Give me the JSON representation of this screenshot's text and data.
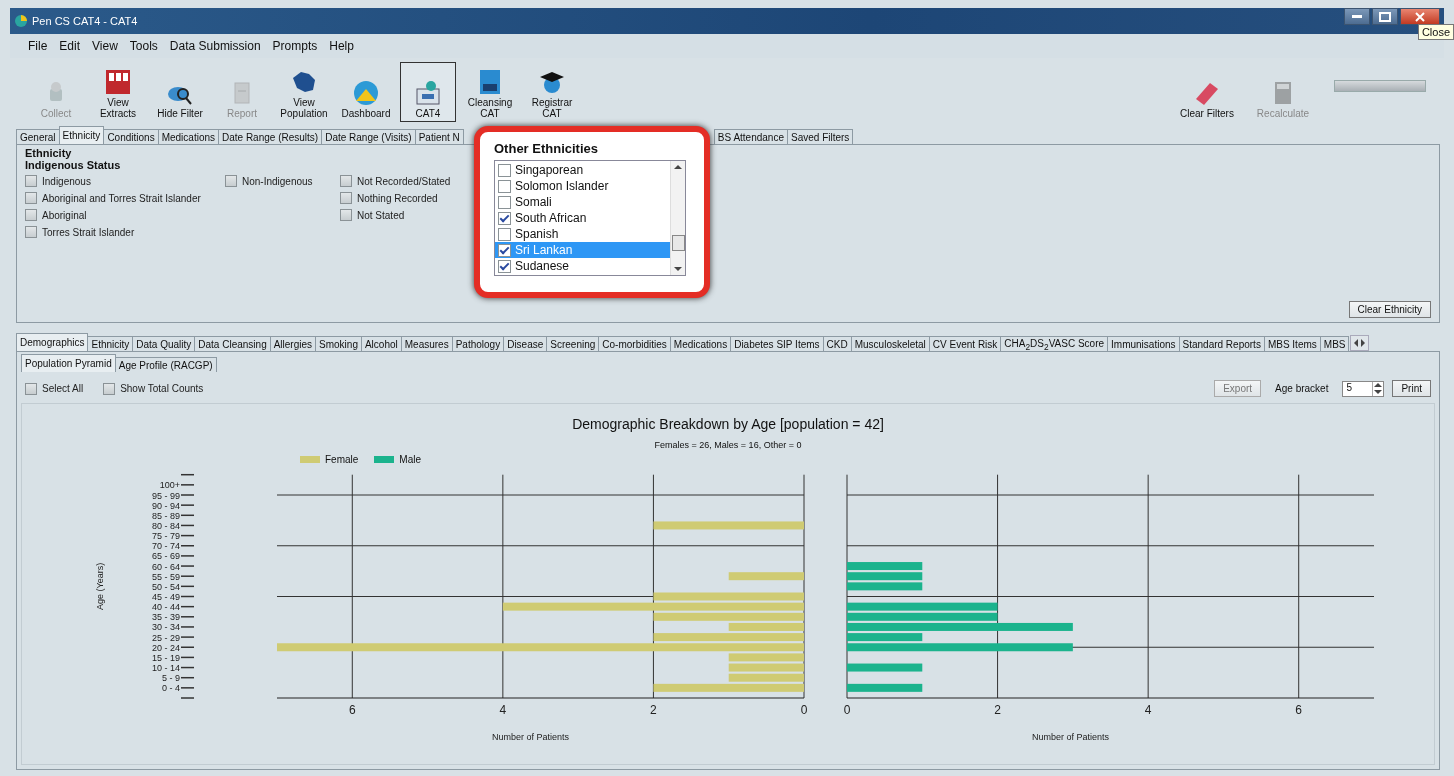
{
  "window": {
    "title": "Pen CS CAT4 - CAT4",
    "tooltip": "Close"
  },
  "menu": [
    "File",
    "Edit",
    "View",
    "Tools",
    "Data Submission",
    "Prompts",
    "Help"
  ],
  "toolbar": [
    {
      "label": "Collect",
      "kind": "collect",
      "disabled": true,
      "selected": false
    },
    {
      "label": "View Extracts",
      "kind": "extracts",
      "disabled": false,
      "selected": false
    },
    {
      "label": "Hide Filter",
      "kind": "filter",
      "disabled": false,
      "selected": false
    },
    {
      "label": "Report",
      "kind": "report",
      "disabled": true,
      "selected": false
    },
    {
      "label": "View Population",
      "kind": "population",
      "disabled": false,
      "selected": false
    },
    {
      "label": "Dashboard",
      "kind": "dashboard",
      "disabled": false,
      "selected": false
    },
    {
      "label": "CAT4",
      "kind": "cat4",
      "disabled": false,
      "selected": true
    },
    {
      "label": "Cleansing CAT",
      "kind": "cleansing",
      "disabled": false,
      "selected": false
    },
    {
      "label": "Registrar CAT",
      "kind": "registrar",
      "disabled": false,
      "selected": false
    }
  ],
  "toolbar_right": [
    {
      "label": "Clear Filters",
      "kind": "eraser",
      "disabled": false
    },
    {
      "label": "Recalculate",
      "kind": "calculator",
      "disabled": true
    }
  ],
  "filter_tabs": [
    {
      "label": "General",
      "selected": false
    },
    {
      "label": "Ethnicity",
      "selected": true
    },
    {
      "label": "Conditions",
      "selected": false
    },
    {
      "label": "Medications",
      "selected": false
    },
    {
      "label": "Date Range (Results)",
      "selected": false
    },
    {
      "label": "Date Range (Visits)",
      "selected": false
    },
    {
      "label": "Patient N",
      "selected": false
    },
    {
      "label": "BS Attendance",
      "selected": false
    },
    {
      "label": "Saved Filters",
      "selected": false
    }
  ],
  "ethnicity": {
    "heading": "Ethnicity",
    "subheading": "Indigenous Status",
    "columns": [
      [
        {
          "label": "Indigenous",
          "checked": false
        },
        {
          "label": "Aboriginal and Torres Strait Islander",
          "checked": false
        },
        {
          "label": "Aboriginal",
          "checked": false
        },
        {
          "label": "Torres Strait Islander",
          "checked": false
        }
      ],
      [
        {
          "label": "Non-Indigenous",
          "checked": false
        }
      ],
      [
        {
          "label": "Not Recorded/Stated",
          "checked": false
        },
        {
          "label": "Nothing Recorded",
          "checked": false
        },
        {
          "label": "Not Stated",
          "checked": false
        }
      ]
    ],
    "clear_button": "Clear Ethnicity"
  },
  "other_ethnicities": {
    "title": "Other Ethnicities",
    "items": [
      {
        "label": "Singaporean",
        "checked": false,
        "selected": false
      },
      {
        "label": "Solomon Islander",
        "checked": false,
        "selected": false
      },
      {
        "label": "Somali",
        "checked": false,
        "selected": false
      },
      {
        "label": "South African",
        "checked": true,
        "selected": false
      },
      {
        "label": "Spanish",
        "checked": false,
        "selected": false
      },
      {
        "label": "Sri Lankan",
        "checked": true,
        "selected": true
      },
      {
        "label": "Sudanese",
        "checked": true,
        "selected": false
      }
    ]
  },
  "report_tabs": [
    {
      "label": "Demographics",
      "selected": true
    },
    {
      "label": "Ethnicity",
      "selected": false
    },
    {
      "label": "Data Quality",
      "selected": false
    },
    {
      "label": "Data Cleansing",
      "selected": false
    },
    {
      "label": "Allergies",
      "selected": false
    },
    {
      "label": "Smoking",
      "selected": false
    },
    {
      "label": "Alcohol",
      "selected": false
    },
    {
      "label": "Measures",
      "selected": false
    },
    {
      "label": "Pathology",
      "selected": false
    },
    {
      "label": "Disease",
      "selected": false
    },
    {
      "label": "Screening",
      "selected": false
    },
    {
      "label": "Co-morbidities",
      "selected": false
    },
    {
      "label": "Medications",
      "selected": false
    },
    {
      "label": "Diabetes SIP Items",
      "selected": false
    },
    {
      "label": "CKD",
      "selected": false
    },
    {
      "label": "Musculoskeletal",
      "selected": false
    },
    {
      "label": "CV Event Risk",
      "selected": false
    },
    {
      "label": "CHA$_{2}$DS$_{2}$VASC Score",
      "selected": false
    },
    {
      "label": "Immunisations",
      "selected": false
    },
    {
      "label": "Standard Reports",
      "selected": false
    },
    {
      "label": "MBS Items",
      "selected": false
    },
    {
      "label": "MBS",
      "selected": false
    }
  ],
  "sub_tabs": [
    {
      "label": "Population Pyramid",
      "selected": true
    },
    {
      "label": "Age Profile (RACGP)",
      "selected": false
    }
  ],
  "options": {
    "select_all": {
      "label": "Select All",
      "checked": false
    },
    "show_total_counts": {
      "label": "Show Total Counts",
      "checked": false
    },
    "export": {
      "label": "Export",
      "disabled": true
    },
    "age_bracket": {
      "label": "Age bracket",
      "value": "5"
    },
    "print": "Print"
  },
  "chart": {
    "title": "Demographic Breakdown by Age [population = 42]",
    "subtitle": "Females = 26, Males = 16, Other = 0",
    "female_chart": {
      "chart_data": {
        "type": "bar",
        "orientation": "horizontal",
        "ylabel": "Age (Years)",
        "xlabel": "Number of Patients",
        "grid": true,
        "xlim": [
          7,
          0
        ],
        "xticks": [
          6,
          4,
          2,
          0
        ],
        "categories": [
          "100+",
          "95 - 99",
          "90 - 94",
          "85 - 89",
          "80 - 84",
          "75 - 79",
          "70 - 74",
          "65 - 69",
          "60 - 64",
          "55 - 59",
          "50 - 54",
          "45 - 49",
          "40 - 44",
          "35 - 39",
          "30 - 34",
          "25 - 29",
          "20 - 24",
          "15 - 19",
          "10 - 14",
          "5 - 9",
          "0 - 4"
        ],
        "series": [
          {
            "name": "Female",
            "color": "#cfcb73",
            "values": [
              0,
              0,
              0,
              0,
              2,
              0,
              0,
              0,
              0,
              1,
              0,
              2,
              4,
              2,
              1,
              2,
              7,
              1,
              1,
              1,
              2
            ]
          }
        ]
      }
    },
    "male_chart": {
      "chart_data": {
        "type": "bar",
        "orientation": "horizontal",
        "xlabel": "Number of Patients",
        "grid": true,
        "xlim": [
          0,
          7
        ],
        "xticks": [
          0,
          2,
          4,
          6
        ],
        "series": [
          {
            "name": "Male",
            "color": "#1bb38d",
            "values": [
              0,
              0,
              0,
              0,
              0,
              0,
              0,
              0,
              1,
              1,
              1,
              0,
              2,
              2,
              3,
              1,
              3,
              0,
              1,
              0,
              1
            ]
          }
        ]
      }
    }
  }
}
